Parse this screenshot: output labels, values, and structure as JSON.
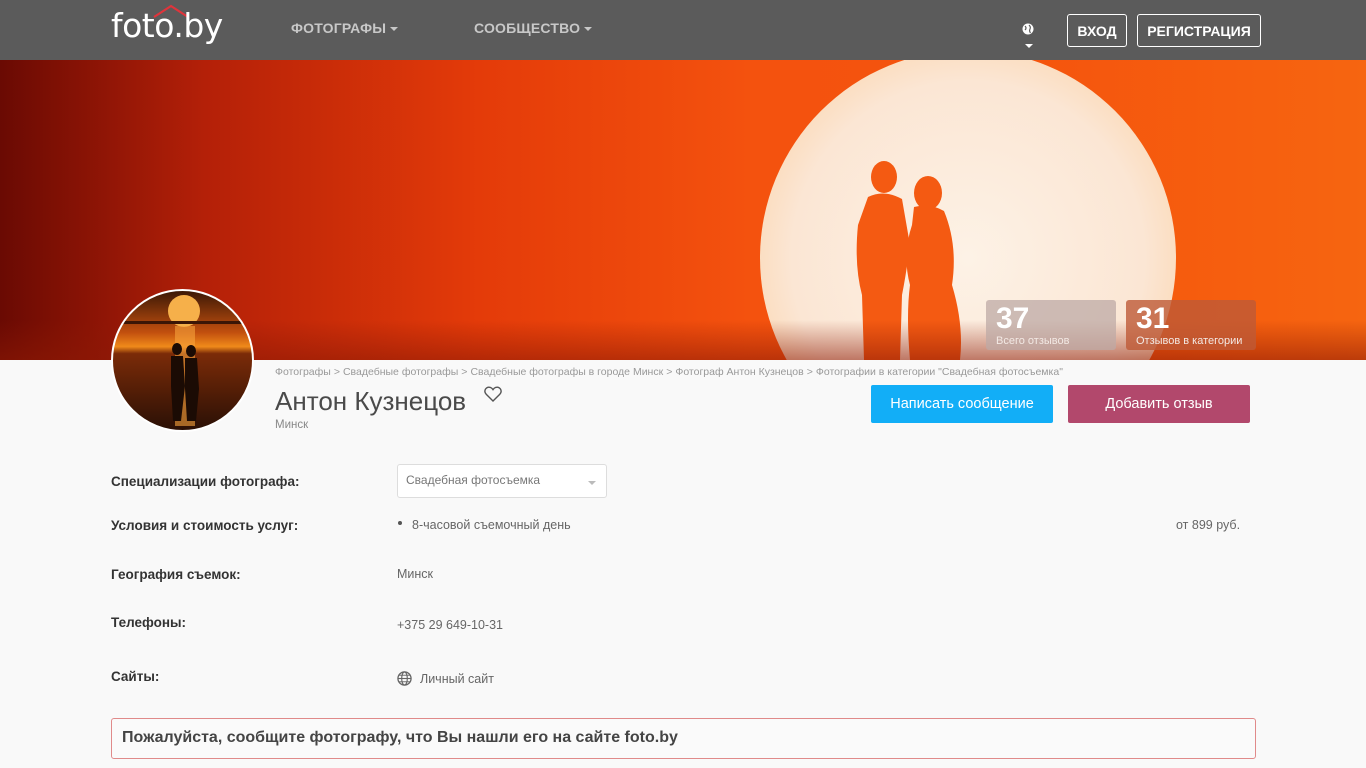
{
  "nav": {
    "logo": "foto.by",
    "menu": [
      {
        "label": "ФОТОГРАФЫ"
      },
      {
        "label": "СООБЩЕСТВО"
      }
    ],
    "login": "ВХОД",
    "register": "РЕГИСТРАЦИЯ"
  },
  "stats": {
    "total_reviews": {
      "value": "37",
      "label": "Всего отзывов"
    },
    "category_reviews": {
      "value": "31",
      "label": "Отзывов в категории"
    }
  },
  "breadcrumbs": [
    "Фотографы",
    "Свадебные фотографы",
    "Свадебные фотографы в городе Минск",
    "Фотограф Антон Кузнецов",
    "Фотографии в категории \"Свадебная фотосъемка\""
  ],
  "profile": {
    "name": "Антон Кузнецов",
    "city": "Минск"
  },
  "actions": {
    "message": "Написать сообщение",
    "review": "Добавить отзыв",
    "message_color": "#12aef7",
    "review_color": "#b2486c"
  },
  "details": {
    "specializations": {
      "label": "Специализации фотографа:",
      "selected": "Свадебная фотосъемка"
    },
    "services": {
      "label": "Условия и стоимость услуг:",
      "item": "8-часовой съемочный день",
      "price": "от 899 руб."
    },
    "geography": {
      "label": "География съемок:",
      "value": "Минск"
    },
    "phones": {
      "label": "Телефоны:",
      "value": "+375 29 649-10-31"
    },
    "sites": {
      "label": "Сайты:",
      "value": "Личный сайт"
    }
  },
  "notice": "Пожалуйста, сообщите фотографу, что Вы нашли его на сайте foto.by"
}
